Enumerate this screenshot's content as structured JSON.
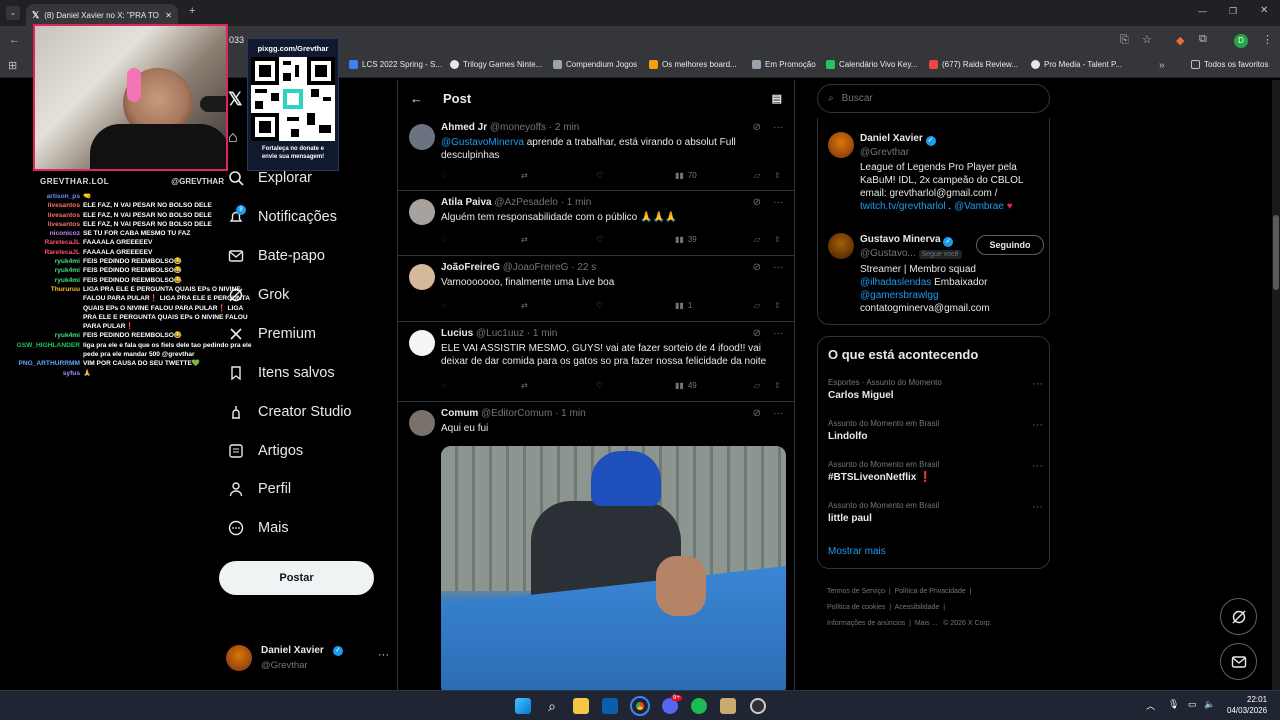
{
  "browser": {
    "tab_title": "(8) Daniel Xavier no X: \"PRA TO",
    "url_fragment": "033",
    "bookmarks": [
      {
        "label": "LCS 2022 Spring - S...",
        "color": "#3b82f6"
      },
      {
        "label": "Trilogy Games Ninte...",
        "color": "#e5e7eb"
      },
      {
        "label": "Compendium Jogos",
        "color": "#9ca3af"
      },
      {
        "label": "Os melhores board...",
        "color": "#f59e0b"
      },
      {
        "label": "Em Promoção",
        "color": "#9ca3af"
      },
      {
        "label": "Calendário Vivo Key...",
        "color": "#22c55e"
      },
      {
        "label": "(677) Raids Review...",
        "color": "#ef4444"
      },
      {
        "label": "Pro Media - Talent P...",
        "color": "#e5e7eb"
      }
    ],
    "all_bookmarks": "Todos os favoritos",
    "profile_initial": "D"
  },
  "overlay": {
    "qr_title": "pixgg.com/Grevthar",
    "qr_caption": "Fortaleça no donate e envie sua mensagem!",
    "handle_left": "GREVTHAR.LOL",
    "handle_right": "@GREVTHAR",
    "chat": [
      {
        "user": "artison_ps",
        "color": "#6b8cff",
        "msg": "🤜"
      },
      {
        "user": "livesantos",
        "color": "#ff6b6b",
        "msg": "ELE FAZ, N VAI PESAR NO BOLSO DELE"
      },
      {
        "user": "livesantos",
        "color": "#ff6b6b",
        "msg": "ELE FAZ, N VAI PESAR NO BOLSO DELE"
      },
      {
        "user": "livesantos",
        "color": "#ff6b6b",
        "msg": "ELE FAZ, N VAI PESAR NO BOLSO DELE"
      },
      {
        "user": "niconicoz",
        "color": "#c084fc",
        "msg": "SE TU FOR CABA MESMO TU FAZ"
      },
      {
        "user": "RaretecaJL",
        "color": "#ff4d6d",
        "msg": "FAAAALA GREEEEEV"
      },
      {
        "user": "RaretecaJL",
        "color": "#ff4d6d",
        "msg": "FAAAALA GREEEEEV"
      },
      {
        "user": "ryuk4mi",
        "color": "#4ade80",
        "msg": "FEIS PEDINDO REEMBOLSO😂"
      },
      {
        "user": "ryuk4mi",
        "color": "#4ade80",
        "msg": "FEIS PEDINDO REEMBOLSO😂"
      },
      {
        "user": "ryuk4mi",
        "color": "#4ade80",
        "msg": "FEIS PEDINDO REEMBOLSO😂"
      },
      {
        "user": "Thururuu",
        "color": "#fbbf24",
        "msg": "LIGA PRA ELE E PERGUNTA QUAIS EPs O NIVINE FALOU PARA PULAR❗ LIGA PRA ELE E PERGUNTA QUAIS EPs O NIVINE FALOU PARA PULAR❗ LIGA PRA ELE E PERGUNTA QUAIS EPs O NIVINE FALOU PARA PULAR❗"
      },
      {
        "user": "ryuk4mi",
        "color": "#4ade80",
        "msg": "FEIS PEDINDO REEMBOLSO😂"
      },
      {
        "user": "GSW_HIGHLANDER",
        "color": "#22c55e",
        "msg": "liga pra ele e fala que os fiels dele tao pedindo pra ele pede pra ele mandar 500 @grevthar"
      },
      {
        "user": "PNG_ARTHURRMM",
        "color": "#60a5fa",
        "msg": "VIM POR CAUSA DO SEU TWETTE💚"
      },
      {
        "user": "syfus",
        "color": "#a78bfa",
        "msg": "🙏"
      }
    ]
  },
  "nav": {
    "items": [
      {
        "label": "Explorar",
        "icon": "search-icon"
      },
      {
        "label": "Notificações",
        "icon": "bell-icon",
        "badge": "8"
      },
      {
        "label": "Bate-papo",
        "icon": "mail-icon"
      },
      {
        "label": "Grok",
        "icon": "grok-icon"
      },
      {
        "label": "Premium",
        "icon": "x-logo-icon"
      },
      {
        "label": "Itens salvos",
        "icon": "bookmark-icon"
      },
      {
        "label": "Creator Studio",
        "icon": "studio-icon"
      },
      {
        "label": "Artigos",
        "icon": "article-icon"
      },
      {
        "label": "Perfil",
        "icon": "person-icon"
      },
      {
        "label": "Mais",
        "icon": "more-icon"
      }
    ],
    "post_button": "Postar",
    "user_name": "Daniel Xavier",
    "user_handle": "@Grevthar"
  },
  "timeline": {
    "title": "Post",
    "tweets": [
      {
        "name": "Ahmed Jr",
        "handle": "@moneyoffs",
        "time": "· 2 min",
        "mention": "@GustavoMinerva",
        "text": " aprende a trabalhar, está virando o absolut Full desculpinhas",
        "views": "70",
        "avatar": "#6b7280"
      },
      {
        "name": "Atila Paiva",
        "handle": "@AzPesadelo",
        "time": "· 1 min",
        "mention": "",
        "text": "Alguém tem responsabilidade com o público 🙏🙏🙏",
        "views": "39",
        "avatar": "#a8a29e"
      },
      {
        "name": "JoãoFreireG",
        "handle": "@JoaoFreireG",
        "time": "· 22 s",
        "mention": "",
        "text": "Vamooooooo, finalmente uma Live boa",
        "views": "1",
        "avatar": "#d6b89a"
      },
      {
        "name": "Lucius",
        "handle": "@Luc1uuz",
        "time": "· 1 min",
        "mention": "",
        "text": "ELE VAI ASSISTIR MESMO, GUYS! vai ate fazer sorteio de 4 ifood!! vai deixar de dar comida para os gatos so pra fazer nossa felicidade da noite",
        "views": "49",
        "avatar": "#f5f5f5"
      },
      {
        "name": "Comum",
        "handle": "@EditorComum",
        "time": "· 1 min",
        "mention": "",
        "text": "Aqui eu fui",
        "views": "",
        "avatar": "#78716c"
      }
    ]
  },
  "right": {
    "search_placeholder": "Buscar",
    "profiles": [
      {
        "name": "Daniel Xavier",
        "handle": "@Grevthar",
        "bio": "League of Legends Pro Player pela KaBuM! IDL, 2x campeão do CBLOL email: grevtharlol@gmail.com /",
        "links": "twitch.tv/grevtharlol",
        "links2": "@Vambrae",
        "heart": "♥",
        "avatar": "#b45309"
      },
      {
        "name": "Gustavo Minerva",
        "handle": "@Gustavo...",
        "follows_you": "Segue você",
        "follow_button": "Seguindo",
        "bio1": "Streamer | Membro squad",
        "bio_link1": "@ilhadaslendas",
        "bio2": " Embaixador",
        "bio_link2": "@gamersbrawlgg",
        "bio3": "contatogminerva@gmail.com",
        "avatar": "#7c2d12"
      }
    ],
    "trends_title": "O que está acontecendo",
    "trends": [
      {
        "category": "Esportes · Assunto do Momento",
        "name": "Carlos Miguel"
      },
      {
        "category": "Assunto do Momento em Brasil",
        "name": "Lindolfo"
      },
      {
        "category": "Assunto do Momento em Brasil",
        "name": "#BTSLiveonNetflix"
      },
      {
        "category": "Assunto do Momento em Brasil",
        "name": "little paul"
      }
    ],
    "show_more": "Mostrar mais",
    "footer_line1": [
      "Termos de Serviço",
      "Política de Privacidade"
    ],
    "footer_line2": [
      "Política de cookies",
      "Acessibilidade"
    ],
    "footer_line3": [
      "Informações de anúncios",
      "Mais ...",
      "© 2026 X Corp."
    ]
  },
  "taskbar": {
    "time": "22:01",
    "date": "04/03/2026",
    "chat_badge": "9+"
  }
}
